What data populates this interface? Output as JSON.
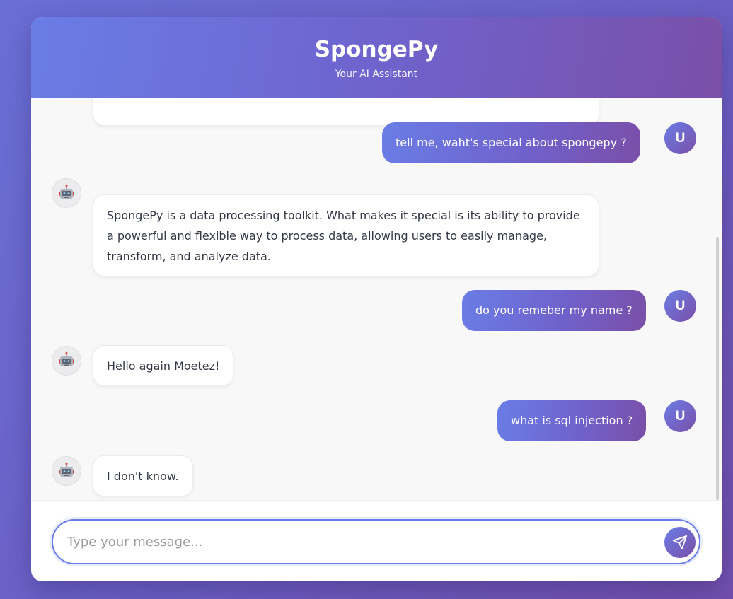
{
  "header": {
    "title": "SpongePy",
    "subtitle": "Your AI Assistant"
  },
  "avatars": {
    "user_initial": "U",
    "bot_icon": "robot-icon"
  },
  "messages": [
    {
      "role": "bot",
      "text": "",
      "partially_visible": true
    },
    {
      "role": "user",
      "text": "tell me, waht's special about spongepy ?"
    },
    {
      "role": "bot",
      "text": "SpongePy is a data processing toolkit. What makes it special is its ability to provide a powerful and flexible way to process data, allowing users to easily manage, transform, and analyze data."
    },
    {
      "role": "user",
      "text": "do you remeber my name ?"
    },
    {
      "role": "bot",
      "text": "Hello again Moetez!"
    },
    {
      "role": "user",
      "text": "what is sql injection ?"
    },
    {
      "role": "bot",
      "text": "I don't know."
    }
  ],
  "input": {
    "placeholder": "Type your message...",
    "value": ""
  },
  "send_button": {
    "icon": "send-icon"
  },
  "colors": {
    "accent_start": "#6a7de6",
    "accent_end": "#7a4fa8",
    "page_background": "#6b63c9",
    "chat_background": "#f8f8f9",
    "bot_bubble": "#ffffff"
  }
}
